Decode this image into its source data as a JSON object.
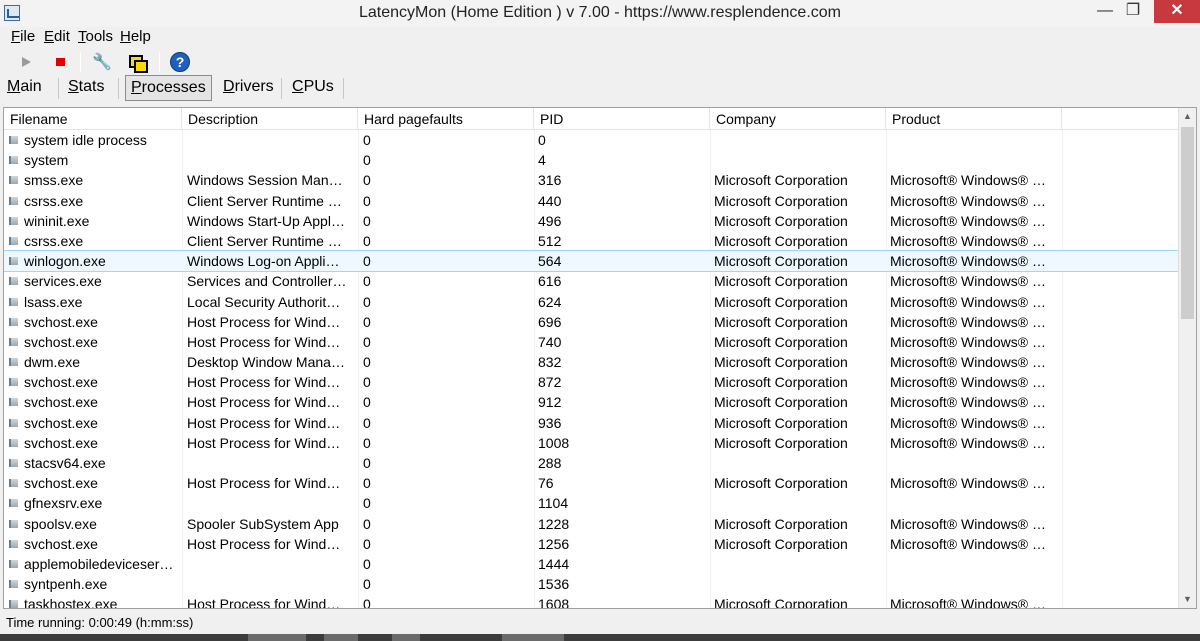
{
  "window": {
    "title": "LatencyMon  (Home Edition )  v 7.00 - https://www.resplendence.com",
    "min_glyph": "—",
    "max_glyph": "❐",
    "close_glyph": "✕"
  },
  "menu": {
    "file": "File",
    "edit": "Edit",
    "tools": "Tools",
    "help": "Help"
  },
  "toolbar": {
    "help_glyph": "?",
    "tool_glyph": "🔧",
    "icons": [
      "play-icon",
      "stop-icon",
      "tools-icon",
      "windows-icon",
      "help-icon"
    ]
  },
  "tabs": {
    "main": "Main",
    "stats": "Stats",
    "processes": "Processes",
    "drivers": "Drivers",
    "cpus": "CPUs",
    "active": "Processes"
  },
  "table": {
    "columns": {
      "filename": "Filename",
      "description": "Description",
      "hard_pagefaults": "Hard pagefaults",
      "pid": "PID",
      "company": "Company",
      "product": "Product"
    },
    "rows": [
      {
        "file": "system idle process",
        "desc": "",
        "hpf": "0",
        "pid": "0",
        "comp": "",
        "prod": ""
      },
      {
        "file": "system",
        "desc": "",
        "hpf": "0",
        "pid": "4",
        "comp": "",
        "prod": ""
      },
      {
        "file": "smss.exe",
        "desc": "Windows Session Man…",
        "hpf": "0",
        "pid": "316",
        "comp": "Microsoft Corporation",
        "prod": "Microsoft® Windows® …"
      },
      {
        "file": "csrss.exe",
        "desc": "Client Server Runtime …",
        "hpf": "0",
        "pid": "440",
        "comp": "Microsoft Corporation",
        "prod": "Microsoft® Windows® …"
      },
      {
        "file": "wininit.exe",
        "desc": "Windows Start-Up Appl…",
        "hpf": "0",
        "pid": "496",
        "comp": "Microsoft Corporation",
        "prod": "Microsoft® Windows® …"
      },
      {
        "file": "csrss.exe",
        "desc": "Client Server Runtime …",
        "hpf": "0",
        "pid": "512",
        "comp": "Microsoft Corporation",
        "prod": "Microsoft® Windows® …"
      },
      {
        "file": "winlogon.exe",
        "desc": "Windows Log-on Appli…",
        "hpf": "0",
        "pid": "564",
        "comp": "Microsoft Corporation",
        "prod": "Microsoft® Windows® …",
        "selected": true
      },
      {
        "file": "services.exe",
        "desc": "Services and Controller…",
        "hpf": "0",
        "pid": "616",
        "comp": "Microsoft Corporation",
        "prod": "Microsoft® Windows® …"
      },
      {
        "file": "lsass.exe",
        "desc": "Local Security Authorit…",
        "hpf": "0",
        "pid": "624",
        "comp": "Microsoft Corporation",
        "prod": "Microsoft® Windows® …"
      },
      {
        "file": "svchost.exe",
        "desc": "Host Process for Wind…",
        "hpf": "0",
        "pid": "696",
        "comp": "Microsoft Corporation",
        "prod": "Microsoft® Windows® …"
      },
      {
        "file": "svchost.exe",
        "desc": "Host Process for Wind…",
        "hpf": "0",
        "pid": "740",
        "comp": "Microsoft Corporation",
        "prod": "Microsoft® Windows® …"
      },
      {
        "file": "dwm.exe",
        "desc": "Desktop Window Mana…",
        "hpf": "0",
        "pid": "832",
        "comp": "Microsoft Corporation",
        "prod": "Microsoft® Windows® …"
      },
      {
        "file": "svchost.exe",
        "desc": "Host Process for Wind…",
        "hpf": "0",
        "pid": "872",
        "comp": "Microsoft Corporation",
        "prod": "Microsoft® Windows® …"
      },
      {
        "file": "svchost.exe",
        "desc": "Host Process for Wind…",
        "hpf": "0",
        "pid": "912",
        "comp": "Microsoft Corporation",
        "prod": "Microsoft® Windows® …"
      },
      {
        "file": "svchost.exe",
        "desc": "Host Process for Wind…",
        "hpf": "0",
        "pid": "936",
        "comp": "Microsoft Corporation",
        "prod": "Microsoft® Windows® …"
      },
      {
        "file": "svchost.exe",
        "desc": "Host Process for Wind…",
        "hpf": "0",
        "pid": "1008",
        "comp": "Microsoft Corporation",
        "prod": "Microsoft® Windows® …"
      },
      {
        "file": "stacsv64.exe",
        "desc": "",
        "hpf": "0",
        "pid": "288",
        "comp": "",
        "prod": ""
      },
      {
        "file": "svchost.exe",
        "desc": "Host Process for Wind…",
        "hpf": "0",
        "pid": "76",
        "comp": "Microsoft Corporation",
        "prod": "Microsoft® Windows® …"
      },
      {
        "file": "gfnexsrv.exe",
        "desc": "",
        "hpf": "0",
        "pid": "1104",
        "comp": "",
        "prod": ""
      },
      {
        "file": "spoolsv.exe",
        "desc": "Spooler SubSystem App",
        "hpf": "0",
        "pid": "1228",
        "comp": "Microsoft Corporation",
        "prod": "Microsoft® Windows® …"
      },
      {
        "file": "svchost.exe",
        "desc": "Host Process for Wind…",
        "hpf": "0",
        "pid": "1256",
        "comp": "Microsoft Corporation",
        "prod": "Microsoft® Windows® …"
      },
      {
        "file": "applemobiledeviceser…",
        "desc": "",
        "hpf": "0",
        "pid": "1444",
        "comp": "",
        "prod": ""
      },
      {
        "file": "syntpenh.exe",
        "desc": "",
        "hpf": "0",
        "pid": "1536",
        "comp": "",
        "prod": ""
      },
      {
        "file": "taskhostex.exe",
        "desc": "Host Process for Wind…",
        "hpf": "0",
        "pid": "1608",
        "comp": "Microsoft Corporation",
        "prod": "Microsoft® Windows® …"
      }
    ]
  },
  "scrollbar": {
    "up_glyph": "▲",
    "down_glyph": "▼"
  },
  "status": {
    "text": "Time running: 0:00:49  (h:mm:ss)"
  },
  "colors": {
    "close_button": "#c7383f",
    "selection_border": "#9fd5ff",
    "stop_icon": "#e00000",
    "help_icon": "#1f5fbf"
  }
}
